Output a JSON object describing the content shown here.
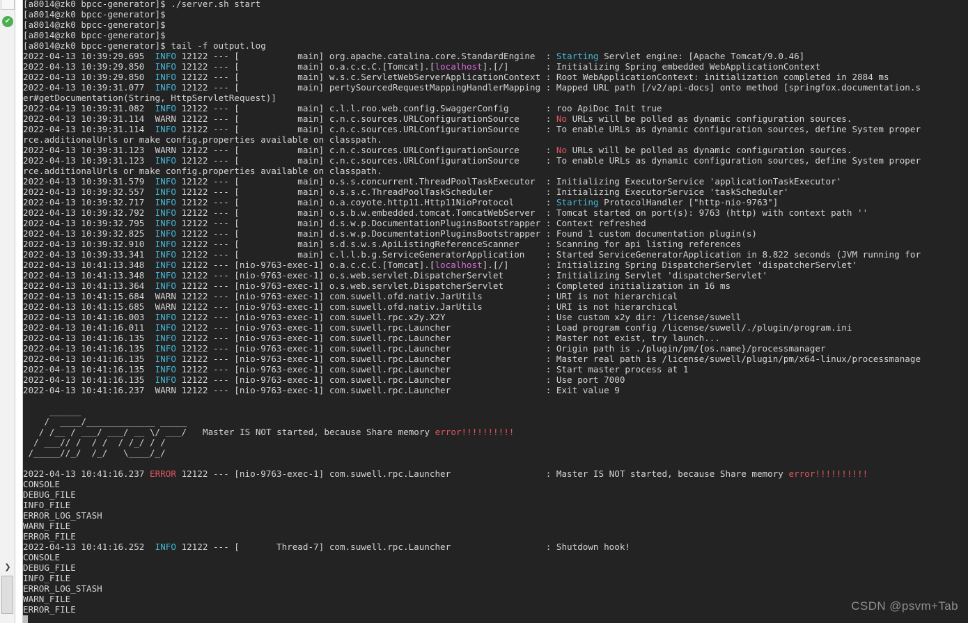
{
  "window": {
    "kind": "terminal-console",
    "background_color": "#232323",
    "foreground_color": "#d4d4d4"
  },
  "gutter": {
    "run_status_icon": "check-circle-icon",
    "run_status_glyph": "✔",
    "run_status_color": "#4caf50",
    "expand_chevron_glyph": "❯",
    "expand_chevron_name": "chevron-right-icon"
  },
  "colors": {
    "info": "#45b6d6",
    "error": "#e05561",
    "magenta": "#d96dd9",
    "text": "#d4d4d4",
    "terminal_bg": "#232323"
  },
  "prompt": {
    "text": "[a8014@zk0 bpcc-generator]$",
    "commands": [
      "./server.sh start",
      "tail -f output.log"
    ]
  },
  "terminal_lines": [
    {
      "type": "prompt",
      "prompt": "[a8014@zk0 bpcc-generator]$ ",
      "cmd": "./server.sh start"
    },
    {
      "type": "prompt",
      "prompt": "[a8014@zk0 bpcc-generator]$",
      "cmd": ""
    },
    {
      "type": "prompt",
      "prompt": "[a8014@zk0 bpcc-generator]$",
      "cmd": ""
    },
    {
      "type": "prompt",
      "prompt": "[a8014@zk0 bpcc-generator]$",
      "cmd": ""
    },
    {
      "type": "prompt",
      "prompt": "[a8014@zk0 bpcc-generator]$ ",
      "cmd": "tail -f output.log"
    },
    {
      "type": "log",
      "ts": "2022-04-13 10:39:29.695",
      "level": "INFO",
      "pid": "12122",
      "thread": "main",
      "logger": "org.apache.catalina.core.StandardEngine",
      "msg_pre": "",
      "msg_hl": "Starting",
      "msg_hl_color": "info",
      "msg_post": " Servlet engine: [Apache Tomcat/9.0.46]"
    },
    {
      "type": "log",
      "ts": "2022-04-13 10:39:29.850",
      "level": "INFO",
      "pid": "12122",
      "thread": "main",
      "logger": "o.a.c.c.C.[Tomcat].[localhost].[/]",
      "logger_hl": "localhost",
      "msg_pre": "Initializing Spring embedded WebApplicationContext",
      "msg_hl": "",
      "msg_post": ""
    },
    {
      "type": "log",
      "ts": "2022-04-13 10:39:29.850",
      "level": "INFO",
      "pid": "12122",
      "thread": "main",
      "logger": "w.s.c.ServletWebServerApplicationContext",
      "msg_pre": "Root WebApplicationContext: initialization completed in 2884 ms",
      "msg_hl": "",
      "msg_post": ""
    },
    {
      "type": "log",
      "ts": "2022-04-13 10:39:31.077",
      "level": "INFO",
      "pid": "12122",
      "thread": "main",
      "logger": "pertySourcedRequestMappingHandlerMapping",
      "msg_pre": "Mapped URL path [/v2/api-docs] onto method [springfox.documentation.s",
      "msg_hl": "",
      "msg_post": ""
    },
    {
      "type": "cont",
      "text": "er#getDocumentation(String, HttpServletRequest)]"
    },
    {
      "type": "log",
      "ts": "2022-04-13 10:39:31.082",
      "level": "INFO",
      "pid": "12122",
      "thread": "main",
      "logger": "c.l.l.roo.web.config.SwaggerConfig",
      "msg_pre": "roo ApiDoc Init true",
      "msg_hl": "",
      "msg_post": ""
    },
    {
      "type": "log",
      "ts": "2022-04-13 10:39:31.114",
      "level": "WARN",
      "pid": "12122",
      "thread": "main",
      "logger": "c.n.c.sources.URLConfigurationSource",
      "msg_pre": "",
      "msg_hl": "No",
      "msg_hl_color": "error",
      "msg_post": " URLs will be polled as dynamic configuration sources."
    },
    {
      "type": "log",
      "ts": "2022-04-13 10:39:31.114",
      "level": "INFO",
      "pid": "12122",
      "thread": "main",
      "logger": "c.n.c.sources.URLConfigurationSource",
      "msg_pre": "To enable URLs as dynamic configuration sources, define System proper",
      "msg_hl": "",
      "msg_post": ""
    },
    {
      "type": "cont",
      "text": "rce.additionalUrls or make config.properties available on classpath."
    },
    {
      "type": "log",
      "ts": "2022-04-13 10:39:31.123",
      "level": "WARN",
      "pid": "12122",
      "thread": "main",
      "logger": "c.n.c.sources.URLConfigurationSource",
      "msg_pre": "",
      "msg_hl": "No",
      "msg_hl_color": "error",
      "msg_post": " URLs will be polled as dynamic configuration sources."
    },
    {
      "type": "log",
      "ts": "2022-04-13 10:39:31.123",
      "level": "INFO",
      "pid": "12122",
      "thread": "main",
      "logger": "c.n.c.sources.URLConfigurationSource",
      "msg_pre": "To enable URLs as dynamic configuration sources, define System proper",
      "msg_hl": "",
      "msg_post": ""
    },
    {
      "type": "cont",
      "text": "rce.additionalUrls or make config.properties available on classpath."
    },
    {
      "type": "log",
      "ts": "2022-04-13 10:39:31.579",
      "level": "INFO",
      "pid": "12122",
      "thread": "main",
      "logger": "o.s.s.concurrent.ThreadPoolTaskExecutor",
      "msg_pre": "Initializing ExecutorService 'applicationTaskExecutor'",
      "msg_hl": "",
      "msg_post": ""
    },
    {
      "type": "log",
      "ts": "2022-04-13 10:39:32.557",
      "level": "INFO",
      "pid": "12122",
      "thread": "main",
      "logger": "o.s.s.c.ThreadPoolTaskScheduler",
      "msg_pre": "Initializing ExecutorService 'taskScheduler'",
      "msg_hl": "",
      "msg_post": ""
    },
    {
      "type": "log",
      "ts": "2022-04-13 10:39:32.717",
      "level": "INFO",
      "pid": "12122",
      "thread": "main",
      "logger": "o.a.coyote.http11.Http11NioProtocol",
      "msg_pre": "",
      "msg_hl": "Starting",
      "msg_hl_color": "info",
      "msg_post": " ProtocolHandler [\"http-nio-9763\"]"
    },
    {
      "type": "log",
      "ts": "2022-04-13 10:39:32.792",
      "level": "INFO",
      "pid": "12122",
      "thread": "main",
      "logger": "o.s.b.w.embedded.tomcat.TomcatWebServer",
      "msg_pre": "Tomcat started on port(s): 9763 (http) with context path ''",
      "msg_hl": "",
      "msg_post": ""
    },
    {
      "type": "log",
      "ts": "2022-04-13 10:39:32.795",
      "level": "INFO",
      "pid": "12122",
      "thread": "main",
      "logger": "d.s.w.p.DocumentationPluginsBootstrapper",
      "msg_pre": "Context refreshed",
      "msg_hl": "",
      "msg_post": ""
    },
    {
      "type": "log",
      "ts": "2022-04-13 10:39:32.825",
      "level": "INFO",
      "pid": "12122",
      "thread": "main",
      "logger": "d.s.w.p.DocumentationPluginsBootstrapper",
      "msg_pre": "Found 1 custom documentation plugin(s)",
      "msg_hl": "",
      "msg_post": ""
    },
    {
      "type": "log",
      "ts": "2022-04-13 10:39:32.910",
      "level": "INFO",
      "pid": "12122",
      "thread": "main",
      "logger": "s.d.s.w.s.ApiListingReferenceScanner",
      "msg_pre": "Scanning for api listing references",
      "msg_hl": "",
      "msg_post": ""
    },
    {
      "type": "log",
      "ts": "2022-04-13 10:39:33.341",
      "level": "INFO",
      "pid": "12122",
      "thread": "main",
      "logger": "c.l.l.b.g.ServiceGeneratorApplication",
      "msg_pre": "Started ServiceGeneratorApplication in 8.822 seconds (JVM running for",
      "msg_hl": "",
      "msg_post": ""
    },
    {
      "type": "log",
      "ts": "2022-04-13 10:41:13.348",
      "level": "INFO",
      "pid": "12122",
      "thread": "nio-9763-exec-1",
      "logger": "o.a.c.c.C.[Tomcat].[localhost].[/]",
      "logger_hl": "localhost",
      "msg_pre": "Initializing Spring DispatcherServlet 'dispatcherServlet'",
      "msg_hl": "",
      "msg_post": ""
    },
    {
      "type": "log",
      "ts": "2022-04-13 10:41:13.348",
      "level": "INFO",
      "pid": "12122",
      "thread": "nio-9763-exec-1",
      "logger": "o.s.web.servlet.DispatcherServlet",
      "msg_pre": "Initializing Servlet 'dispatcherServlet'",
      "msg_hl": "",
      "msg_post": ""
    },
    {
      "type": "log",
      "ts": "2022-04-13 10:41:13.364",
      "level": "INFO",
      "pid": "12122",
      "thread": "nio-9763-exec-1",
      "logger": "o.s.web.servlet.DispatcherServlet",
      "msg_pre": "Completed initialization in 16 ms",
      "msg_hl": "",
      "msg_post": ""
    },
    {
      "type": "log",
      "ts": "2022-04-13 10:41:15.684",
      "level": "WARN",
      "pid": "12122",
      "thread": "nio-9763-exec-1",
      "logger": "com.suwell.ofd.nativ.JarUtils",
      "msg_pre": "URI is not hierarchical",
      "msg_hl": "",
      "msg_post": ""
    },
    {
      "type": "log",
      "ts": "2022-04-13 10:41:15.685",
      "level": "WARN",
      "pid": "12122",
      "thread": "nio-9763-exec-1",
      "logger": "com.suwell.ofd.nativ.JarUtils",
      "msg_pre": "URI is not hierarchical",
      "msg_hl": "",
      "msg_post": ""
    },
    {
      "type": "log",
      "ts": "2022-04-13 10:41:16.003",
      "level": "INFO",
      "pid": "12122",
      "thread": "nio-9763-exec-1",
      "logger": "com.suwell.rpc.x2y.X2Y",
      "msg_pre": "Use custom x2y dir: /license/suwell",
      "msg_hl": "",
      "msg_post": ""
    },
    {
      "type": "log",
      "ts": "2022-04-13 10:41:16.011",
      "level": "INFO",
      "pid": "12122",
      "thread": "nio-9763-exec-1",
      "logger": "com.suwell.rpc.Launcher",
      "msg_pre": "Load program config /license/suwell/./plugin/program.ini",
      "msg_hl": "",
      "msg_post": ""
    },
    {
      "type": "log",
      "ts": "2022-04-13 10:41:16.135",
      "level": "INFO",
      "pid": "12122",
      "thread": "nio-9763-exec-1",
      "logger": "com.suwell.rpc.Launcher",
      "msg_pre": "Master not exist, try launch...",
      "msg_hl": "",
      "msg_post": ""
    },
    {
      "type": "log",
      "ts": "2022-04-13 10:41:16.135",
      "level": "INFO",
      "pid": "12122",
      "thread": "nio-9763-exec-1",
      "logger": "com.suwell.rpc.Launcher",
      "msg_pre": "Origin path is ./plugin/pm/{os.name}/processmanager",
      "msg_hl": "",
      "msg_post": ""
    },
    {
      "type": "log",
      "ts": "2022-04-13 10:41:16.135",
      "level": "INFO",
      "pid": "12122",
      "thread": "nio-9763-exec-1",
      "logger": "com.suwell.rpc.Launcher",
      "msg_pre": "Master real path is /license/suwell/plugin/pm/x64-linux/processmanage",
      "msg_hl": "",
      "msg_post": ""
    },
    {
      "type": "log",
      "ts": "2022-04-13 10:41:16.135",
      "level": "INFO",
      "pid": "12122",
      "thread": "nio-9763-exec-1",
      "logger": "com.suwell.rpc.Launcher",
      "msg_pre": "Start master process at 1",
      "msg_hl": "",
      "msg_post": ""
    },
    {
      "type": "log",
      "ts": "2022-04-13 10:41:16.135",
      "level": "INFO",
      "pid": "12122",
      "thread": "nio-9763-exec-1",
      "logger": "com.suwell.rpc.Launcher",
      "msg_pre": "Use port 7000",
      "msg_hl": "",
      "msg_post": ""
    },
    {
      "type": "log",
      "ts": "2022-04-13 10:41:16.237",
      "level": "WARN",
      "pid": "12122",
      "thread": "nio-9763-exec-1",
      "logger": "com.suwell.rpc.Launcher",
      "msg_pre": "Exit value 9",
      "msg_hl": "",
      "msg_post": ""
    },
    {
      "type": "blank"
    },
    {
      "type": "banner"
    },
    {
      "type": "blank"
    },
    {
      "type": "log",
      "ts": "2022-04-13 10:41:16.237",
      "level": "ERROR",
      "pid": "12122",
      "thread": "nio-9763-exec-1",
      "logger": "com.suwell.rpc.Launcher",
      "msg_pre": "Master IS NOT started, because Share memory ",
      "msg_hl": "error!!!!!!!!!!",
      "msg_hl_color": "error",
      "msg_post": ""
    },
    {
      "type": "plain",
      "text": "CONSOLE"
    },
    {
      "type": "plain",
      "text": "DEBUG_FILE"
    },
    {
      "type": "plain",
      "text": "INFO_FILE"
    },
    {
      "type": "plain",
      "text": "ERROR_LOG_STASH"
    },
    {
      "type": "plain",
      "text": "WARN_FILE"
    },
    {
      "type": "plain",
      "text": "ERROR_FILE"
    },
    {
      "type": "log",
      "ts": "2022-04-13 10:41:16.252",
      "level": "INFO",
      "pid": "12122",
      "thread": "Thread-7",
      "logger": "com.suwell.rpc.Launcher",
      "msg_pre": "Shutdown hook!",
      "msg_hl": "",
      "msg_post": ""
    },
    {
      "type": "plain",
      "text": "CONSOLE"
    },
    {
      "type": "plain",
      "text": "DEBUG_FILE"
    },
    {
      "type": "plain",
      "text": "INFO_FILE"
    },
    {
      "type": "plain",
      "text": "ERROR_LOG_STASH"
    },
    {
      "type": "plain",
      "text": "WARN_FILE"
    },
    {
      "type": "plain",
      "text": "ERROR_FILE"
    },
    {
      "type": "cursor"
    }
  ],
  "banner": {
    "ascii_art_name": "error-figlet-banner",
    "lines": [
      "     ______                        ",
      "    /  ____/_____________ _____    ",
      "   / /__ / ___/ ___/ __ \\/ ___/    ",
      "  / ___// /  / /  / /_/ / /        ",
      " /_____//_/  /_/   \\____/_/        "
    ],
    "message_pre": "Master IS NOT started, because Share memory ",
    "message_hl": "error!!!!!!!!!!"
  },
  "watermark": {
    "text": "CSDN @psvm+Tab"
  }
}
